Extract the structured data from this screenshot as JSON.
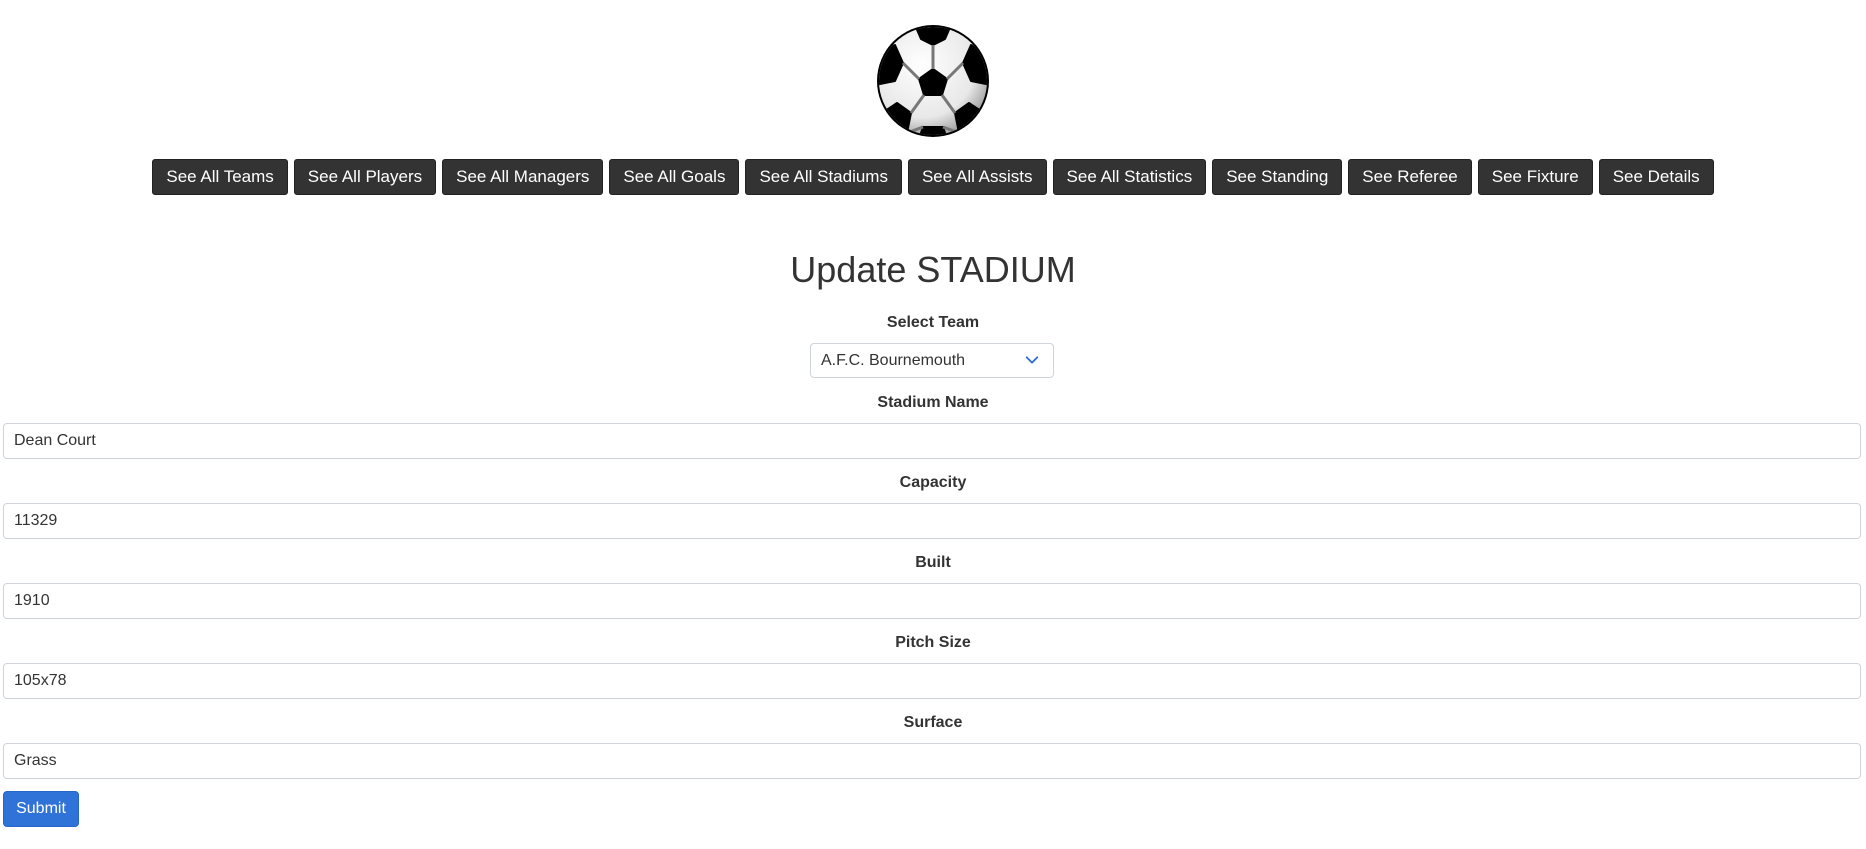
{
  "nav": {
    "items": [
      {
        "label": "See All Teams"
      },
      {
        "label": "See All Players"
      },
      {
        "label": "See All Managers"
      },
      {
        "label": "See All Goals"
      },
      {
        "label": "See All Stadiums"
      },
      {
        "label": "See All Assists"
      },
      {
        "label": "See All Statistics"
      },
      {
        "label": "See Standing"
      },
      {
        "label": "See Referee"
      },
      {
        "label": "See Fixture"
      },
      {
        "label": "See Details"
      }
    ]
  },
  "form": {
    "title": "Update STADIUM",
    "select_team": {
      "label": "Select Team",
      "value": "A.F.C. Bournemouth"
    },
    "stadium_name": {
      "label": "Stadium Name",
      "value": "Dean Court"
    },
    "capacity": {
      "label": "Capacity",
      "value": "11329"
    },
    "built": {
      "label": "Built",
      "value": "1910"
    },
    "pitch_size": {
      "label": "Pitch Size",
      "value": "105x78"
    },
    "surface": {
      "label": "Surface",
      "value": "Grass"
    },
    "submit_label": "Submit"
  },
  "icons": {
    "logo": "soccer-ball-icon",
    "select_arrow": "chevron-down-icon"
  },
  "colors": {
    "nav_button_bg": "#333333",
    "submit_bg": "#2f72d8"
  }
}
